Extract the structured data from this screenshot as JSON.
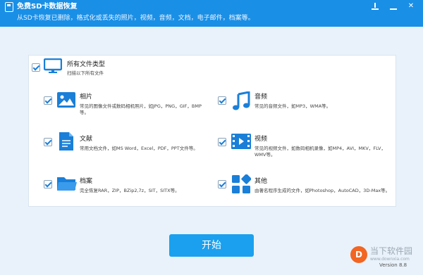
{
  "window": {
    "title": "免费SD卡数据恢复",
    "subtitle": "从SD卡恢复已删除，格式化或丢失的照片，视频，音频，文档，电子邮件，档案等。"
  },
  "all_types": {
    "title": "所有文件类型",
    "desc": "扫描以下所有文件"
  },
  "types": {
    "photo": {
      "title": "相片",
      "desc": "常见的图像文件或数码相机照片，如JPG，PNG，GIF，BMP等。"
    },
    "audio": {
      "title": "音频",
      "desc": "常见的音频文件，如MP3，WMA等。"
    },
    "doc": {
      "title": "文献",
      "desc": "常用文档文件，如MS Word，Excel，PDF，PPT文件等。"
    },
    "video": {
      "title": "视频",
      "desc": "常见的视频文件，如数码相机录像，如MP4，AVI，MKV，FLV，WMV等。"
    },
    "archive": {
      "title": "档案",
      "desc": "完全恢复RAR，ZIP，BZip2,7z，SIT，SITX等。"
    },
    "other": {
      "title": "其他",
      "desc": "由著名程序生成的文件，如Photoshop，AutoCAD，3D-Max等。"
    }
  },
  "start_label": "开始",
  "version": "Version 8.8",
  "watermark": {
    "badge": "D",
    "text": "当下软件园",
    "url": "www.downxia.com"
  },
  "colors": {
    "accent": "#1a8fe6",
    "icon": "#1a7fd8",
    "button": "#1aa0ee"
  }
}
